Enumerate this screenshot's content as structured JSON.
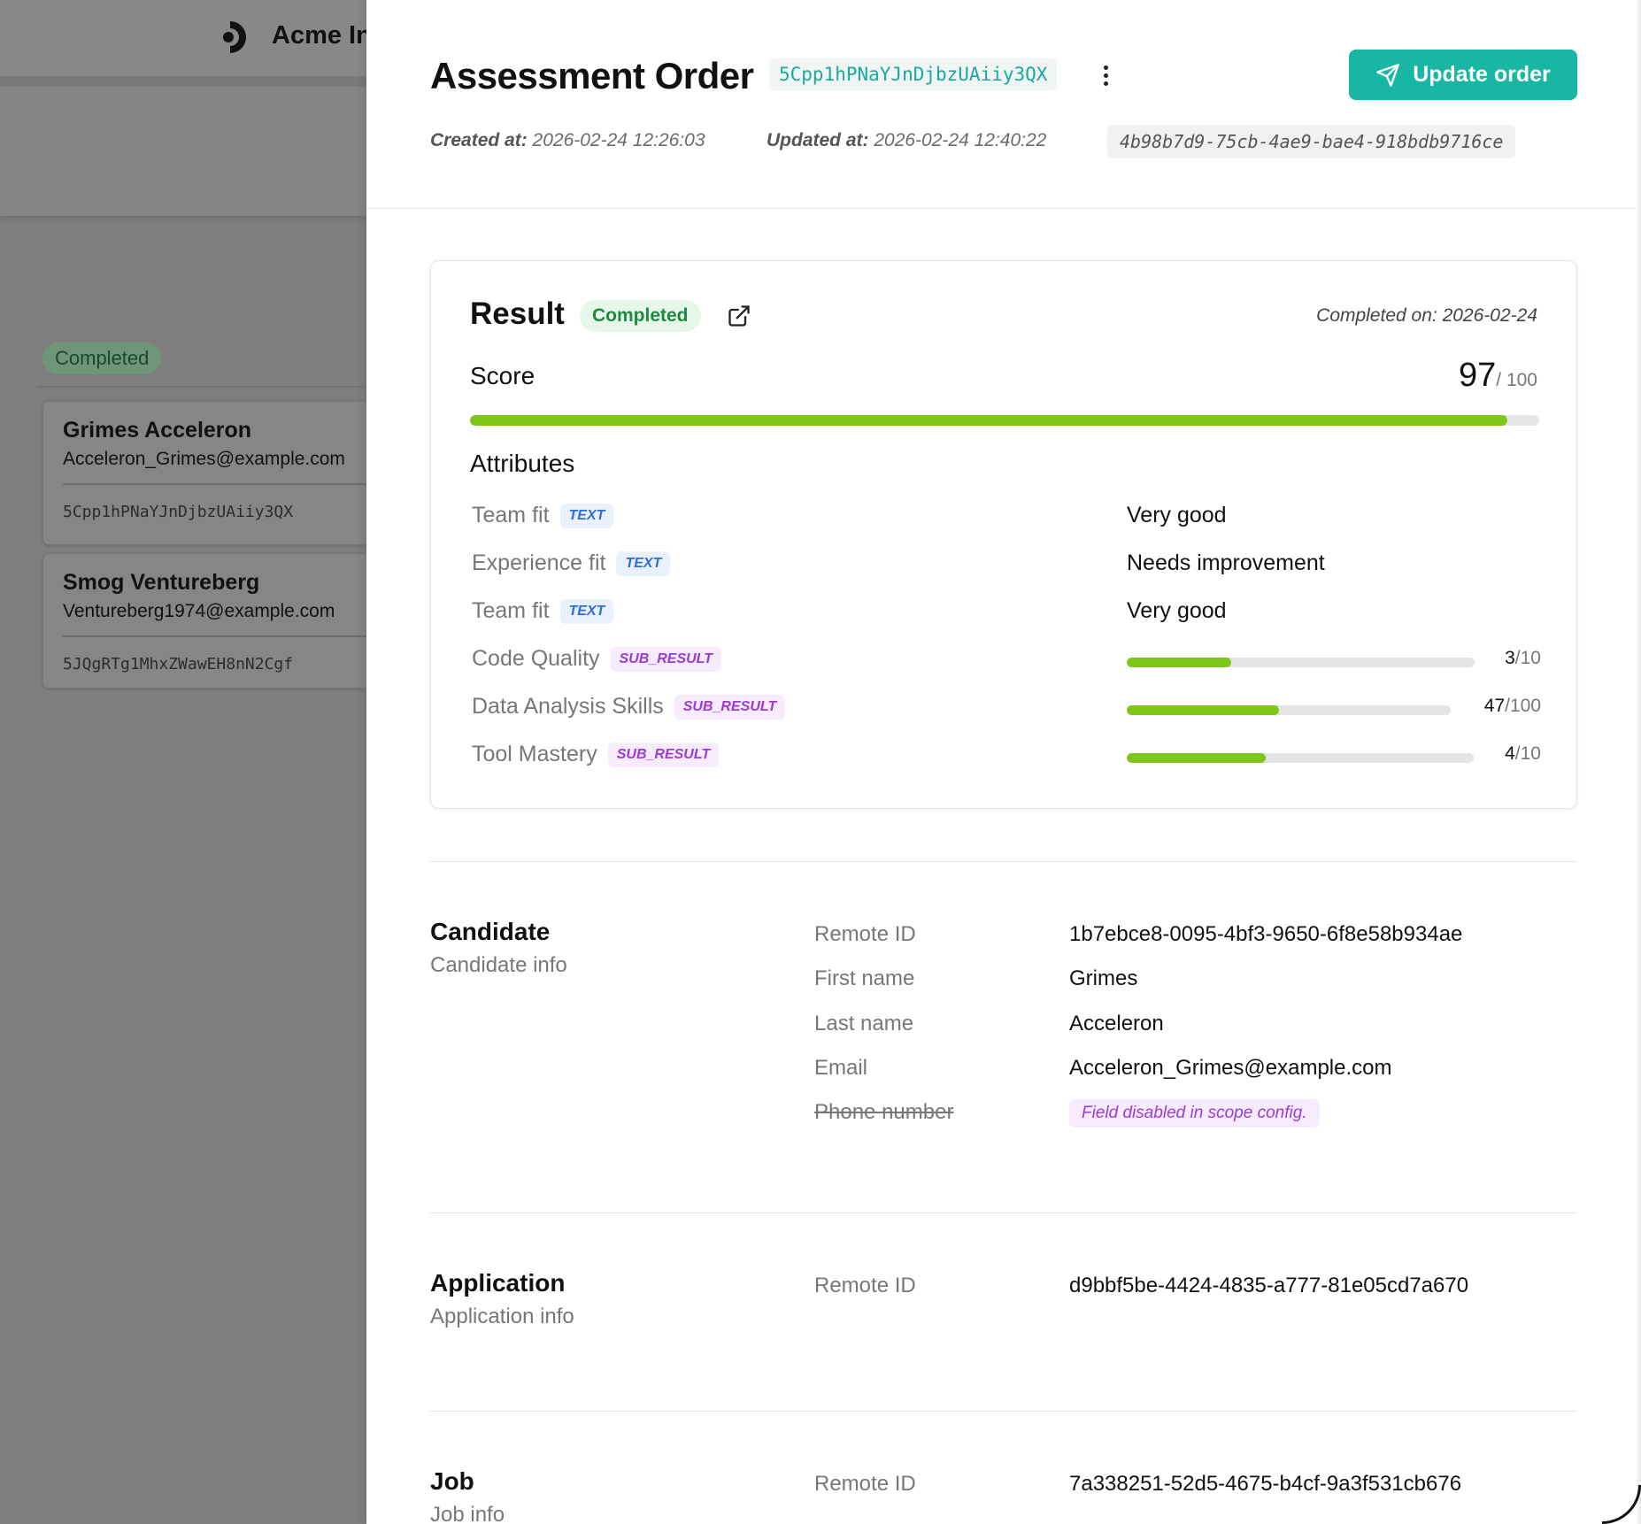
{
  "background": {
    "company_name": "Acme Inc",
    "status_label": "Completed",
    "cards": [
      {
        "name": "Grimes Acceleron",
        "email": "Acceleron_Grimes@example.com",
        "order_id": "5Cpp1hPNaYJnDjbzUAiiy3QX"
      },
      {
        "name": "Smog Ventureberg",
        "email": "Ventureberg1974@example.com",
        "order_id": "5JQgRTg1MhxZWawEH8nN2Cgf"
      }
    ]
  },
  "header": {
    "title": "Assessment Order",
    "order_id": "5Cpp1hPNaYJnDjbzUAiiy3QX",
    "update_button": "Update order",
    "created_label": "Created at:",
    "created_value": "2026-02-24 12:26:03",
    "updated_label": "Updated at:",
    "updated_value": "2026-02-24 12:40:22",
    "uuid": "4b98b7d9-75cb-4ae9-bae4-918bdb9716ce",
    "accent_color": "#17b7a4"
  },
  "result": {
    "title": "Result",
    "status": "Completed",
    "completed_on": "Completed on: 2026-02-24",
    "score_label": "Score",
    "score": 97,
    "score_max_text": "/ 100",
    "score_fraction": 0.97,
    "attributes_heading": "Attributes",
    "attributes": [
      {
        "name": "Team fit",
        "tag": "TEXT",
        "kind": "text",
        "value": "Very good"
      },
      {
        "name": "Experience fit",
        "tag": "TEXT",
        "kind": "text",
        "value": "Needs improvement"
      },
      {
        "name": "Team fit",
        "tag": "TEXT",
        "kind": "text",
        "value": "Very good"
      },
      {
        "name": "Code Quality",
        "tag": "SUB_RESULT",
        "kind": "sub",
        "score": "3",
        "max": "/10",
        "fraction": 0.3
      },
      {
        "name": "Data Analysis Skills",
        "tag": "SUB_RESULT",
        "kind": "sub",
        "score": "47",
        "max": "/100",
        "fraction": 0.47
      },
      {
        "name": "Tool Mastery",
        "tag": "SUB_RESULT",
        "kind": "sub",
        "score": "4",
        "max": "/10",
        "fraction": 0.4
      }
    ],
    "bar_color": "#7ec71a"
  },
  "candidate": {
    "title": "Candidate",
    "subtitle": "Candidate info",
    "fields": [
      {
        "key": "Remote ID",
        "value": "1b7ebce8-0095-4bf3-9650-6f8e58b934ae"
      },
      {
        "key": "First name",
        "value": "Grimes"
      },
      {
        "key": "Last name",
        "value": "Acceleron"
      },
      {
        "key": "Email",
        "value": "Acceleron_Grimes@example.com"
      }
    ],
    "disabled_field": {
      "key": "Phone number",
      "note": "Field disabled in scope config."
    }
  },
  "application": {
    "title": "Application",
    "subtitle": "Application info",
    "fields": [
      {
        "key": "Remote ID",
        "value": "d9bbf5be-4424-4835-a777-81e05cd7a670"
      }
    ]
  },
  "job": {
    "title": "Job",
    "subtitle": "Job info",
    "fields": [
      {
        "key": "Remote ID",
        "value": "7a338251-52d5-4675-b4cf-9a3f531cb676"
      }
    ]
  }
}
